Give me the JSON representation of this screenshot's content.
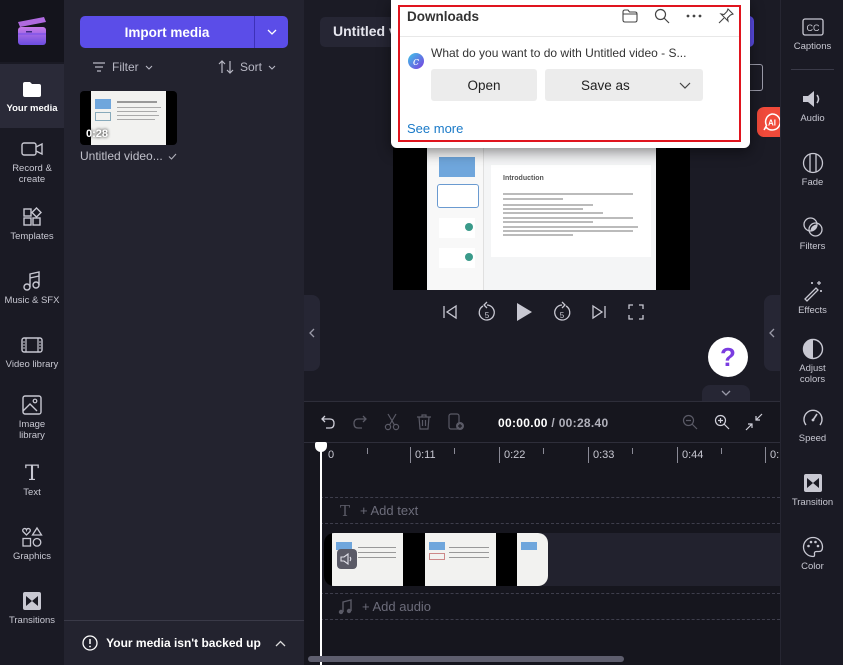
{
  "left_nav": {
    "items": [
      {
        "label": "Your media",
        "icon": "folder-icon",
        "active": true
      },
      {
        "label": "Record & create",
        "icon": "camera-icon"
      },
      {
        "label": "Templates",
        "icon": "templates-icon"
      },
      {
        "label": "Music & SFX",
        "icon": "music-icon"
      },
      {
        "label": "Video library",
        "icon": "film-icon"
      },
      {
        "label": "Image library",
        "icon": "image-icon"
      },
      {
        "label": "Text",
        "icon": "text-icon"
      },
      {
        "label": "Graphics",
        "icon": "shapes-icon"
      },
      {
        "label": "Transitions",
        "icon": "transition-icon"
      }
    ]
  },
  "media_panel": {
    "import_label": "Import media",
    "filter_label": "Filter",
    "sort_label": "Sort",
    "items": [
      {
        "name": "Untitled video...",
        "duration": "0:28",
        "added": true
      }
    ],
    "backup_notice": "Your media isn't backed up"
  },
  "header": {
    "project_title": "Untitled video"
  },
  "downloads": {
    "title": "Downloads",
    "message": "What do you want to do with Untitled video - S...",
    "open_label": "Open",
    "save_as_label": "Save as",
    "see_more_label": "See more",
    "highlight_color": "#e0141e"
  },
  "preview": {
    "slide_heading": "Introduction"
  },
  "timeline": {
    "current_time": "00:00.00",
    "separator": "/",
    "total_time": "00:28.40",
    "ruler_ticks": [
      "0",
      "0:11",
      "0:22",
      "0:33",
      "0:44",
      "0:"
    ],
    "add_text_label": "+ Add text",
    "add_audio_label": "+ Add audio"
  },
  "right_panel": {
    "items": [
      {
        "label": "Captions",
        "icon": "captions-icon"
      },
      {
        "label": "Audio",
        "icon": "speaker-icon"
      },
      {
        "label": "Fade",
        "icon": "fade-icon"
      },
      {
        "label": "Filters",
        "icon": "filters-icon"
      },
      {
        "label": "Effects",
        "icon": "magic-wand-icon"
      },
      {
        "label": "Adjust colors",
        "icon": "contrast-icon"
      },
      {
        "label": "Speed",
        "icon": "speedometer-icon"
      },
      {
        "label": "Transition",
        "icon": "transition-icon"
      },
      {
        "label": "Color",
        "icon": "palette-icon"
      }
    ]
  },
  "help": {
    "label": "?"
  },
  "ai": {
    "label": "AI"
  },
  "colors": {
    "accent": "#5b4de8",
    "ai_badge": "#f04a3a",
    "link": "#1a7ac8"
  }
}
